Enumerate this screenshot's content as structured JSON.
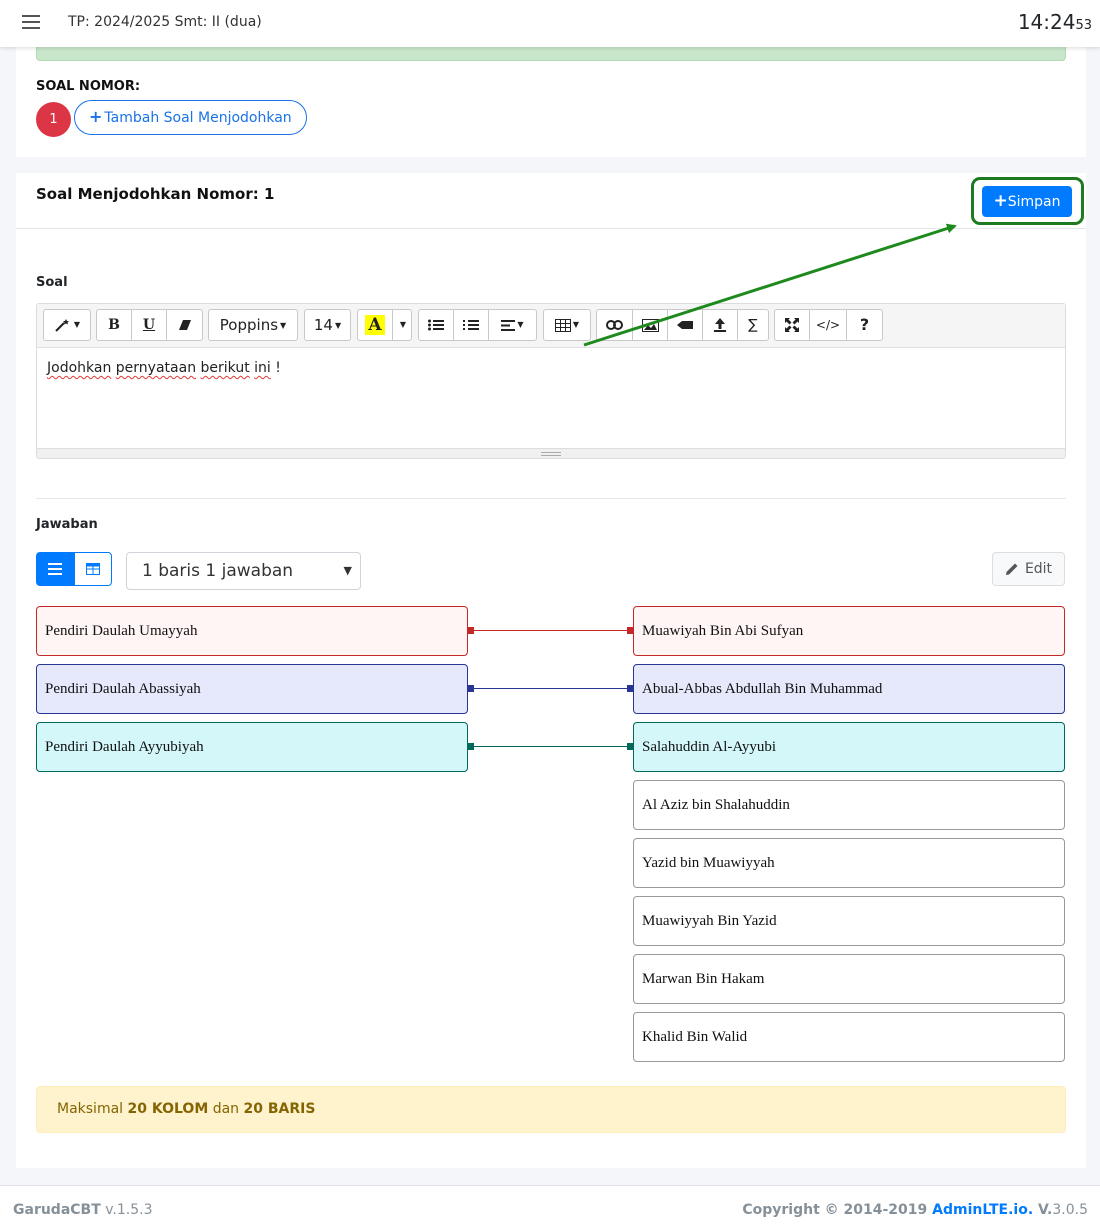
{
  "header": {
    "tp": "TP: 2024/2025 Smt: II (dua)",
    "clock_hm": "14:24",
    "clock_sec": "53"
  },
  "soal_nomor": {
    "label": "SOAL NOMOR:",
    "number": "1",
    "add_button": "Tambah Soal Menjodohkan"
  },
  "editor_card": {
    "title": "Soal Menjodohkan Nomor: 1",
    "save_button": "Simpan",
    "soal_label": "Soal",
    "toolbar": {
      "font_family": "Poppins",
      "font_size": "14",
      "color_a": "A",
      "help": "?"
    },
    "content_words": [
      "Jodohkan",
      "pernyataan",
      "berikut",
      "ini",
      "!"
    ]
  },
  "jawaban": {
    "label": "Jawaban",
    "select_value": "1 baris 1 jawaban",
    "edit_button": "Edit",
    "left_items": [
      {
        "text": "Pendiri Daulah Umayyah",
        "color": "#c62828",
        "bg": "#fff5f5"
      },
      {
        "text": "Pendiri Daulah Abassiyah",
        "color": "#283593",
        "bg": "#e6e8fb"
      },
      {
        "text": "Pendiri Daulah Ayyubiyah",
        "color": "#00695c",
        "bg": "#d4f7f9"
      }
    ],
    "right_items": [
      {
        "text": "Muawiyah Bin Abi Sufyan",
        "color": "#c62828",
        "bg": "#fff5f5"
      },
      {
        "text": "Abual-Abbas Abdullah Bin Muhammad",
        "color": "#283593",
        "bg": "#e6e8fb"
      },
      {
        "text": "Salahuddin Al-Ayyubi",
        "color": "#00695c",
        "bg": "#d4f7f9"
      },
      {
        "text": "Al Aziz bin Shalahuddin",
        "color": "#999999",
        "bg": "#ffffff"
      },
      {
        "text": "Yazid bin Muawiyyah",
        "color": "#999999",
        "bg": "#ffffff"
      },
      {
        "text": "Muawiyyah Bin Yazid",
        "color": "#999999",
        "bg": "#ffffff"
      },
      {
        "text": "Marwan Bin Hakam",
        "color": "#999999",
        "bg": "#ffffff"
      },
      {
        "text": "Khalid Bin Walid",
        "color": "#999999",
        "bg": "#ffffff"
      }
    ],
    "alert": {
      "prefix": "Maksimal ",
      "kolom": "20 KOLOM",
      "mid": " dan ",
      "baris": "20 BARIS"
    }
  },
  "footer": {
    "app_name": "GarudaCBT",
    "app_version": " v.1.5.3",
    "copyright": "Copyright © 2014-2019 ",
    "link": "AdminLTE.io.",
    "v_label": " V.",
    "version": "3.0.5"
  },
  "colors": {
    "primary": "#007bff",
    "danger": "#dc3545",
    "highlight_border": "#1e7a1e",
    "arrow": "#1e8a1e"
  }
}
